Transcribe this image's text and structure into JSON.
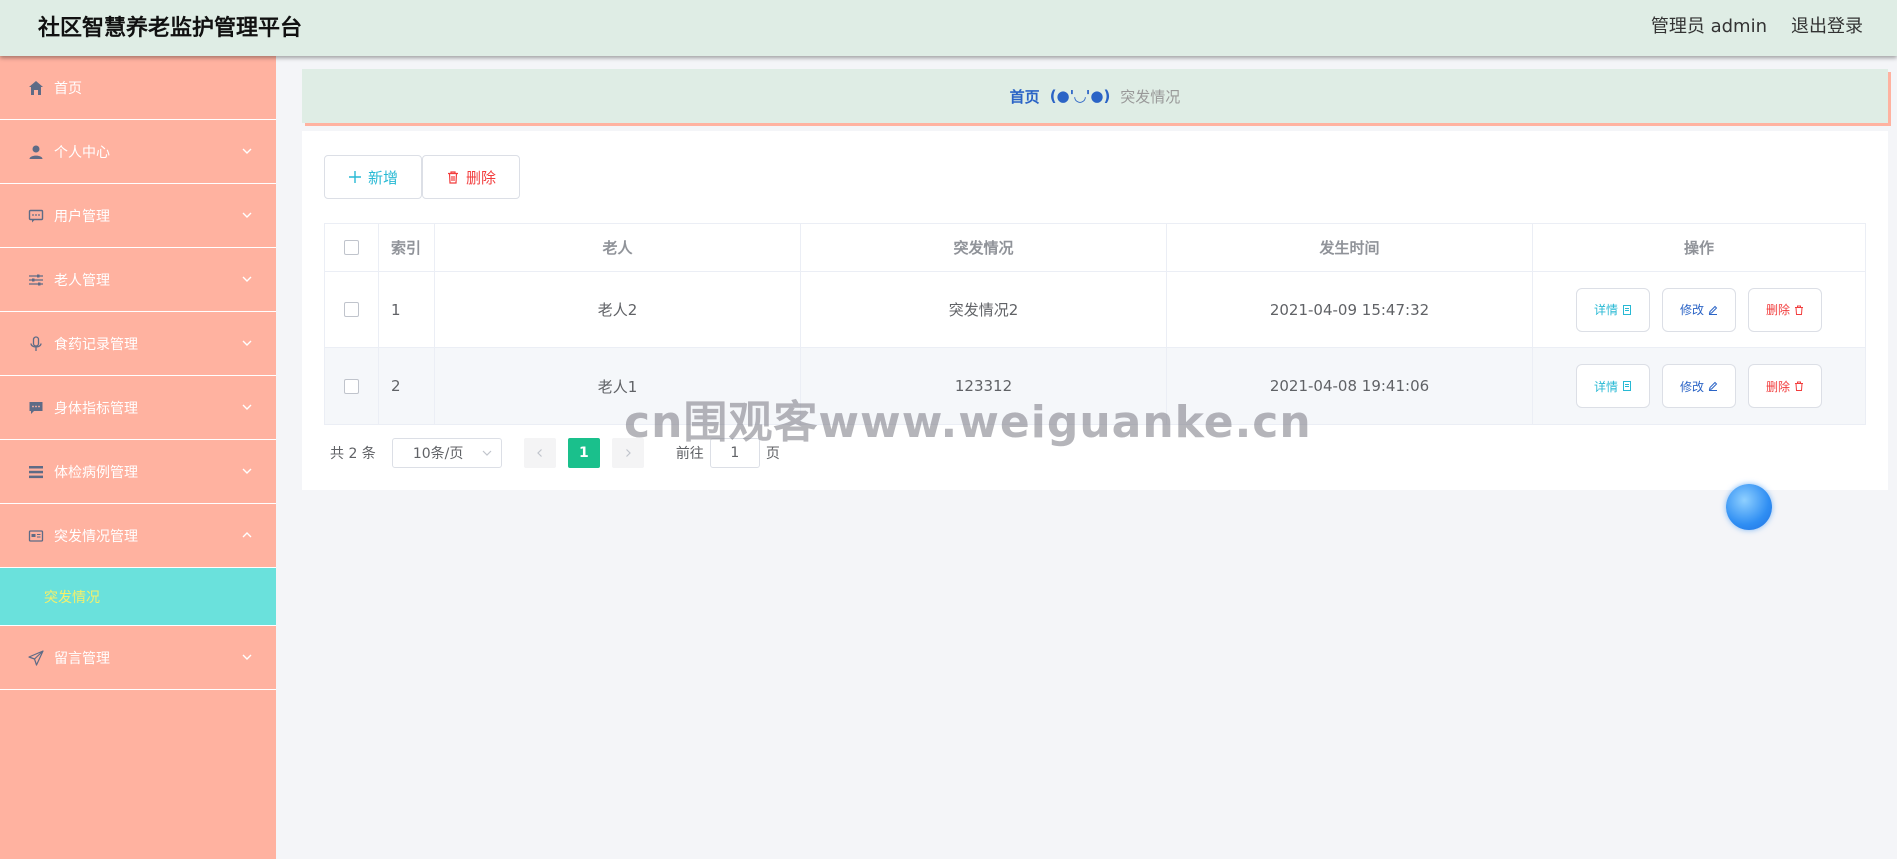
{
  "header": {
    "title": "社区智慧养老监护管理平台",
    "admin_label": "管理员 admin",
    "logout_label": "退出登录"
  },
  "sidebar": {
    "items": [
      {
        "label": "首页",
        "icon": "home-icon"
      },
      {
        "label": "个人中心",
        "icon": "user-icon"
      },
      {
        "label": "用户管理",
        "icon": "chat-icon"
      },
      {
        "label": "老人管理",
        "icon": "sliders-icon"
      },
      {
        "label": "食药记录管理",
        "icon": "microphone-icon"
      },
      {
        "label": "身体指标管理",
        "icon": "message-icon"
      },
      {
        "label": "体检病例管理",
        "icon": "list-icon"
      },
      {
        "label": "突发情况管理",
        "icon": "card-icon"
      },
      {
        "label": "留言管理",
        "icon": "send-icon"
      }
    ],
    "sub_active": "突发情况"
  },
  "breadcrumb": {
    "home": "首页",
    "separator": "(●'◡'●)",
    "current": "突发情况"
  },
  "toolbar": {
    "add_label": "新增",
    "delete_label": "删除"
  },
  "table": {
    "headers": [
      "索引",
      "老人",
      "突发情况",
      "发生时间",
      "操作"
    ],
    "rows": [
      {
        "index": "1",
        "elder": "老人2",
        "situation": "突发情况2",
        "time": "2021-04-09 15:47:32"
      },
      {
        "index": "2",
        "elder": "老人1",
        "situation": "123312",
        "time": "2021-04-08 19:41:06"
      }
    ],
    "ops": {
      "detail": "详情",
      "edit": "修改",
      "delete": "删除"
    }
  },
  "pagination": {
    "total_text": "共 2 条",
    "page_size": "10条/页",
    "current_page": "1",
    "goto_prefix": "前往",
    "goto_value": "1",
    "goto_suffix": "页"
  },
  "watermark": "cn围观客www.weiguanke.cn",
  "colors": {
    "header_bg": "#dfede5",
    "sidebar_bg": "#ffb2a0",
    "submenu_active_bg": "#6ae1dc",
    "submenu_active_text": "#f5f06a",
    "accent_blue": "#2b64c6",
    "accent_cyan": "#28b9d4",
    "danger": "#f23d3d",
    "pager_active": "#1ac08c"
  }
}
